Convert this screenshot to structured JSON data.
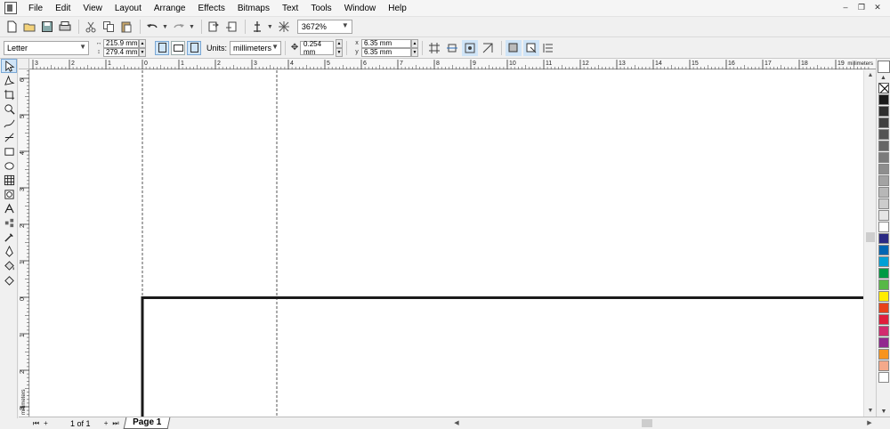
{
  "menubar": {
    "items": [
      {
        "label": "File",
        "key": "F"
      },
      {
        "label": "Edit",
        "key": "E"
      },
      {
        "label": "View",
        "key": "V"
      },
      {
        "label": "Layout",
        "key": "L"
      },
      {
        "label": "Arrange",
        "key": "A"
      },
      {
        "label": "Effects",
        "key": "c"
      },
      {
        "label": "Bitmaps",
        "key": "B"
      },
      {
        "label": "Text",
        "key": "T"
      },
      {
        "label": "Tools",
        "key": "o"
      },
      {
        "label": "Window",
        "key": "W"
      },
      {
        "label": "Help",
        "key": "H"
      }
    ]
  },
  "toolbar": {
    "zoom_value": "3672%"
  },
  "property_bar": {
    "page_size": "Letter",
    "page_width": "215.9 mm",
    "page_height": "279.4 mm",
    "units_label": "Units:",
    "units_value": "millimeters",
    "nudge_value": "0.254 mm",
    "duplicate_x": "6.35 mm",
    "duplicate_y": "6.35 mm"
  },
  "rulers": {
    "horizontal_ticks": [
      "3",
      "2",
      "1",
      "0",
      "1",
      "2",
      "3",
      "4",
      "5",
      "6",
      "7",
      "8",
      "9",
      "10",
      "11",
      "12",
      "13",
      "14",
      "15",
      "16",
      "17",
      "18",
      "19"
    ],
    "horizontal_unit": "millimeters",
    "vertical_ticks": [
      "6",
      "5",
      "4",
      "3",
      "2",
      "1",
      "0",
      "1",
      "2",
      "3"
    ],
    "vertical_unit": "millimeters"
  },
  "statusbar": {
    "page_count": "1 of 1",
    "page_tab": "Page 1"
  },
  "palette": {
    "swatches": [
      "#1a1a1a",
      "#2e2e2e",
      "#404040",
      "#545454",
      "#666666",
      "#7b7b7b",
      "#8e8e8e",
      "#a3a3a3",
      "#b7b7b7",
      "#cccccc",
      "#e6e6e6",
      "#ffffff",
      "#2b2a83",
      "#0066b3",
      "#00a0d6",
      "#009a44",
      "#57b847",
      "#ffed00",
      "#e8421a",
      "#e01e3c",
      "#d22b6f",
      "#92278f",
      "#f7941d",
      "#f4a98a",
      "#ffffff",
      "#b9a6cf",
      "#9a8bc4",
      "#6c65ae",
      "#5a5aa8",
      "#4f4f9b",
      "#444490",
      "#3a3a85",
      "#30307a"
    ]
  }
}
